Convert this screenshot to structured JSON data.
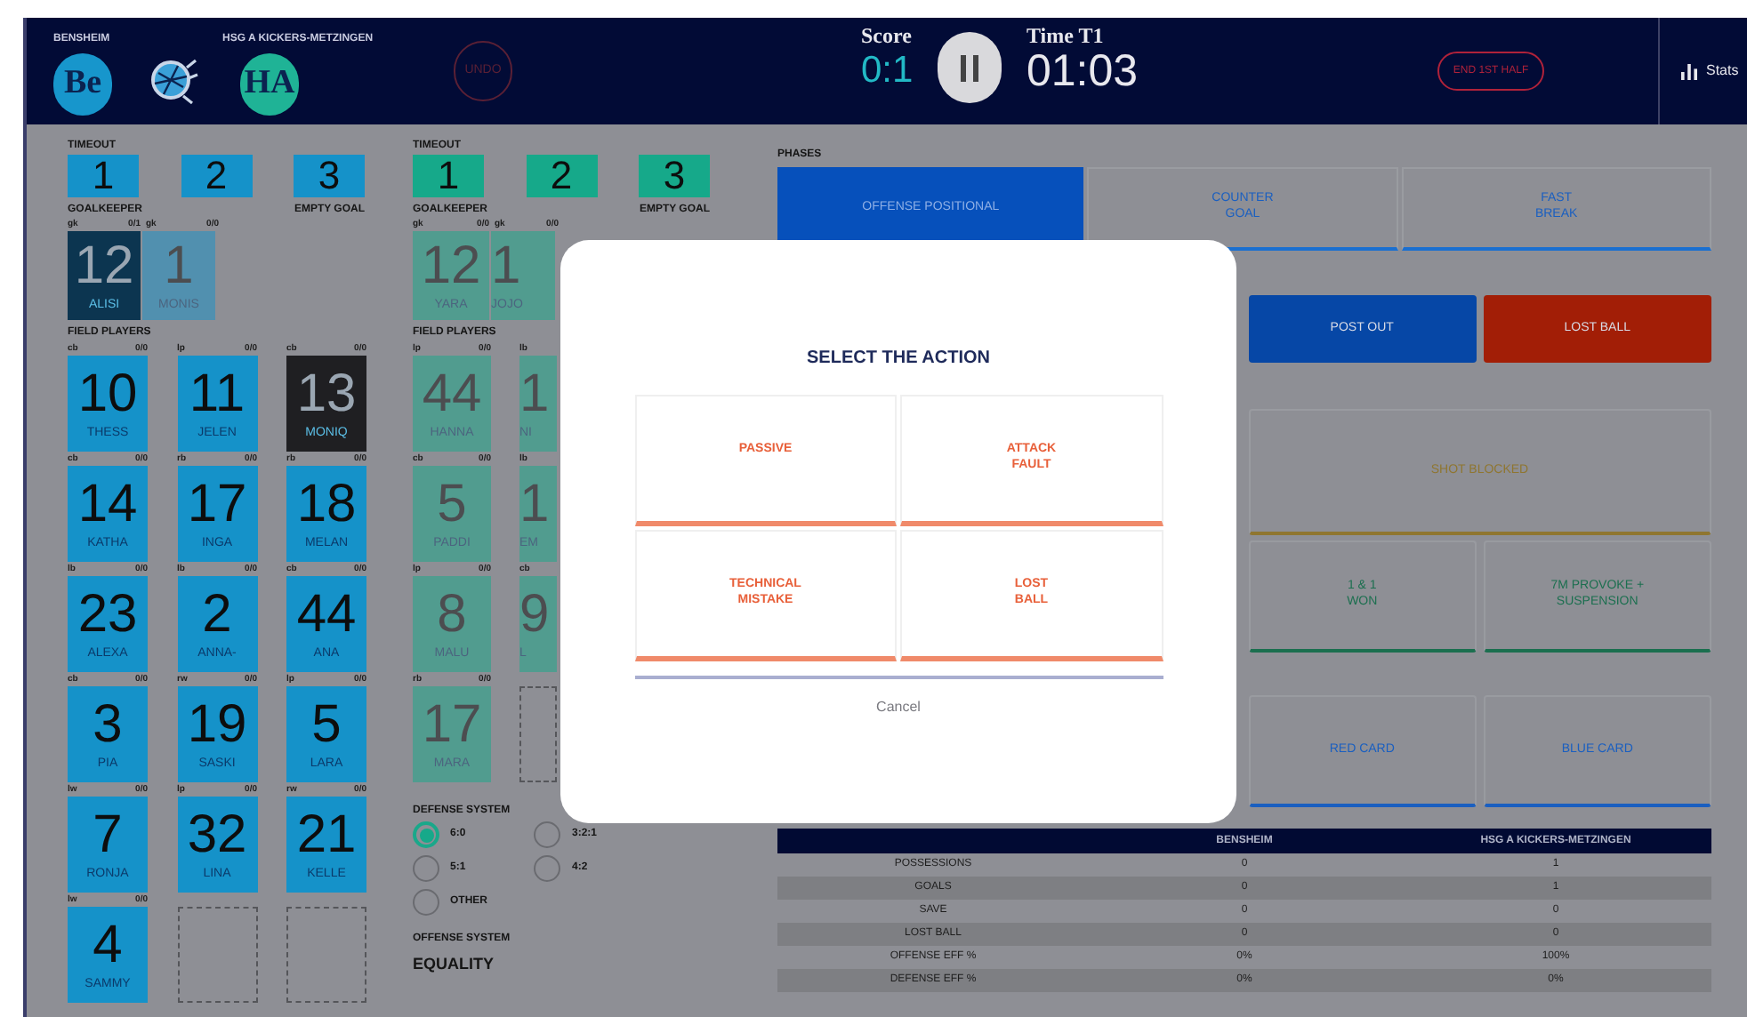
{
  "header": {
    "teams": [
      {
        "name": "BENSHEIM",
        "initials": "Be",
        "color": "#1796cc"
      },
      {
        "name": "HSG A KICKERS-METZINGEN",
        "initials": "HA",
        "color": "#1fb396"
      }
    ],
    "undo": {
      "label": "UNDO",
      "disabled": true
    },
    "score": {
      "label": "Score",
      "value": "0:1"
    },
    "time": {
      "label": "Time T1",
      "value": "01:03"
    },
    "end_half": "END 1ST HALF",
    "stats": "Stats"
  },
  "teams": [
    {
      "active": true,
      "color": "#1592c9",
      "timeout_label": "TIMEOUT",
      "timeouts": [
        "1",
        "2",
        "3"
      ],
      "goalkeeper_label": "GOALKEEPER",
      "empty_goal": "EMPTY GOAL",
      "goalkeepers": [
        {
          "position": "gk",
          "stat": "0/1",
          "number": "12",
          "name": "ALISI",
          "selected": true
        },
        {
          "position": "gk",
          "stat": "0/0",
          "number": "1",
          "name": "MONIS",
          "selected": false
        }
      ],
      "field_label": "FIELD PLAYERS",
      "rows": [
        [
          {
            "kind": "player",
            "position": "cb",
            "stat": "0/0",
            "number": "10",
            "name": "THESS",
            "selected": false
          },
          {
            "kind": "player",
            "position": "lp",
            "stat": "0/0",
            "number": "11",
            "name": "JELEN",
            "selected": false
          },
          {
            "kind": "player",
            "position": "cb",
            "stat": "0/0",
            "number": "13",
            "name": "MONIQ",
            "selected": true
          }
        ],
        [
          {
            "kind": "player",
            "position": "cb",
            "stat": "0/0",
            "number": "14",
            "name": "KATHA",
            "selected": false
          },
          {
            "kind": "player",
            "position": "rb",
            "stat": "0/0",
            "number": "17",
            "name": "INGA",
            "selected": false
          },
          {
            "kind": "player",
            "position": "rb",
            "stat": "0/0",
            "number": "18",
            "name": "MELAN",
            "selected": false
          }
        ],
        [
          {
            "kind": "player",
            "position": "lb",
            "stat": "0/0",
            "number": "23",
            "name": "ALEXA",
            "selected": false
          },
          {
            "kind": "player",
            "position": "lb",
            "stat": "0/0",
            "number": "2",
            "name": "ANNA-",
            "selected": false
          },
          {
            "kind": "player",
            "position": "cb",
            "stat": "0/0",
            "number": "44",
            "name": "ANA",
            "selected": false
          }
        ],
        [
          {
            "kind": "player",
            "position": "cb",
            "stat": "0/0",
            "number": "3",
            "name": "PIA",
            "selected": false
          },
          {
            "kind": "player",
            "position": "rw",
            "stat": "0/0",
            "number": "19",
            "name": "SASKI",
            "selected": false
          },
          {
            "kind": "player",
            "position": "lp",
            "stat": "0/0",
            "number": "5",
            "name": "LARA",
            "selected": false
          }
        ],
        [
          {
            "kind": "player",
            "position": "lw",
            "stat": "0/0",
            "number": "7",
            "name": "RONJA",
            "selected": false
          },
          {
            "kind": "player",
            "position": "lp",
            "stat": "0/0",
            "number": "32",
            "name": "LINA",
            "selected": false
          },
          {
            "kind": "player",
            "position": "rw",
            "stat": "0/0",
            "number": "21",
            "name": "KELLE",
            "selected": false
          }
        ],
        [
          {
            "kind": "player",
            "position": "lw",
            "stat": "0/0",
            "number": "4",
            "name": "SAMMY",
            "selected": false
          },
          {
            "kind": "empty"
          },
          {
            "kind": "empty"
          }
        ]
      ]
    },
    {
      "active": false,
      "color": "#16a98a",
      "timeout_label": "TIMEOUT",
      "timeouts": [
        "1",
        "2",
        "3"
      ],
      "goalkeeper_label": "GOALKEEPER",
      "empty_goal": "EMPTY GOAL",
      "goalkeepers": [
        {
          "position": "gk",
          "stat": "0/0",
          "number": "12",
          "name": "YARA",
          "selected": false
        },
        {
          "position": "gk",
          "stat": "0/0",
          "number": "1",
          "name": "JOJO",
          "selected": false
        }
      ],
      "field_label": "FIELD PLAYERS",
      "rows": [
        [
          {
            "kind": "player",
            "position": "lp",
            "stat": "0/0",
            "number": "44",
            "name": "HANNA",
            "selected": false
          },
          {
            "kind": "player",
            "position": "lb",
            "number": "1",
            "name": "NI",
            "selected": false
          }
        ],
        [
          {
            "kind": "player",
            "position": "cb",
            "stat": "0/0",
            "number": "5",
            "name": "PADDI",
            "selected": false
          },
          {
            "kind": "player",
            "position": "lb",
            "number": "1",
            "name": "EM",
            "selected": false
          }
        ],
        [
          {
            "kind": "player",
            "position": "lp",
            "stat": "0/0",
            "number": "8",
            "name": "MALU",
            "selected": false
          },
          {
            "kind": "player",
            "position": "cb",
            "number": "9",
            "name": "L",
            "selected": false
          }
        ],
        [
          {
            "kind": "player",
            "position": "rb",
            "stat": "0/0",
            "number": "17",
            "name": "MARA",
            "selected": false
          },
          {
            "kind": "empty"
          }
        ]
      ]
    }
  ],
  "defense_system": {
    "label": "DEFENSE SYSTEM",
    "options": [
      {
        "label": "6:0",
        "selected": true
      },
      {
        "label": "5:1",
        "selected": false
      },
      {
        "label": "OTHER",
        "selected": false
      },
      {
        "label": "3:2:1",
        "selected": false
      },
      {
        "label": "4:2",
        "selected": false
      }
    ]
  },
  "offense_system": {
    "label": "OFFENSE SYSTEM",
    "value": "EQUALITY"
  },
  "phases": {
    "label": "PHASES",
    "items": [
      {
        "label": "OFFENSE POSITIONAL",
        "selected": true
      },
      {
        "label": "COUNTER\nGOAL",
        "selected": false
      },
      {
        "label": "FAST\nBREAK",
        "selected": false
      }
    ]
  },
  "action_rows": [
    [
      {
        "kind": "filled",
        "label": "POST OUT",
        "color": "#0647a6"
      },
      {
        "kind": "filled",
        "label": "LOST BALL",
        "color": "#a21e06"
      }
    ],
    [
      {
        "kind": "outline",
        "label": "SHOT BLOCKED",
        "color": "#8f7630"
      }
    ],
    [
      {
        "kind": "outline",
        "label": "1 & 1\nWON",
        "color": "#1b6f4f"
      },
      {
        "kind": "outline",
        "label": "7M PROVOKE +\nSUSPENSION",
        "color": "#1b6f4f"
      }
    ],
    [
      {
        "kind": "outline",
        "label": "RED CARD",
        "color": "#1a5fc0"
      },
      {
        "kind": "outline",
        "label": "BLUE CARD",
        "color": "#1a5fc0"
      }
    ]
  ],
  "stats_table": {
    "columns": [
      "BENSHEIM",
      "HSG A KICKERS-METZINGEN"
    ],
    "rows": [
      {
        "label": "POSSESSIONS",
        "values": [
          "0",
          "1"
        ]
      },
      {
        "label": "GOALS",
        "values": [
          "0",
          "1"
        ]
      },
      {
        "label": "SAVE",
        "values": [
          "0",
          "0"
        ]
      },
      {
        "label": "LOST BALL",
        "values": [
          "0",
          "0"
        ]
      },
      {
        "label": "OFFENSE EFF %",
        "values": [
          "0%",
          "100%"
        ]
      },
      {
        "label": "DEFENSE EFF %",
        "values": [
          "0%",
          "0%"
        ]
      }
    ]
  },
  "modal": {
    "title": "SELECT THE ACTION",
    "actions": [
      "PASSIVE",
      "ATTACK\nFAULT",
      "TECHNICAL\nMISTAKE",
      "LOST\nBALL"
    ],
    "cancel": "Cancel"
  }
}
